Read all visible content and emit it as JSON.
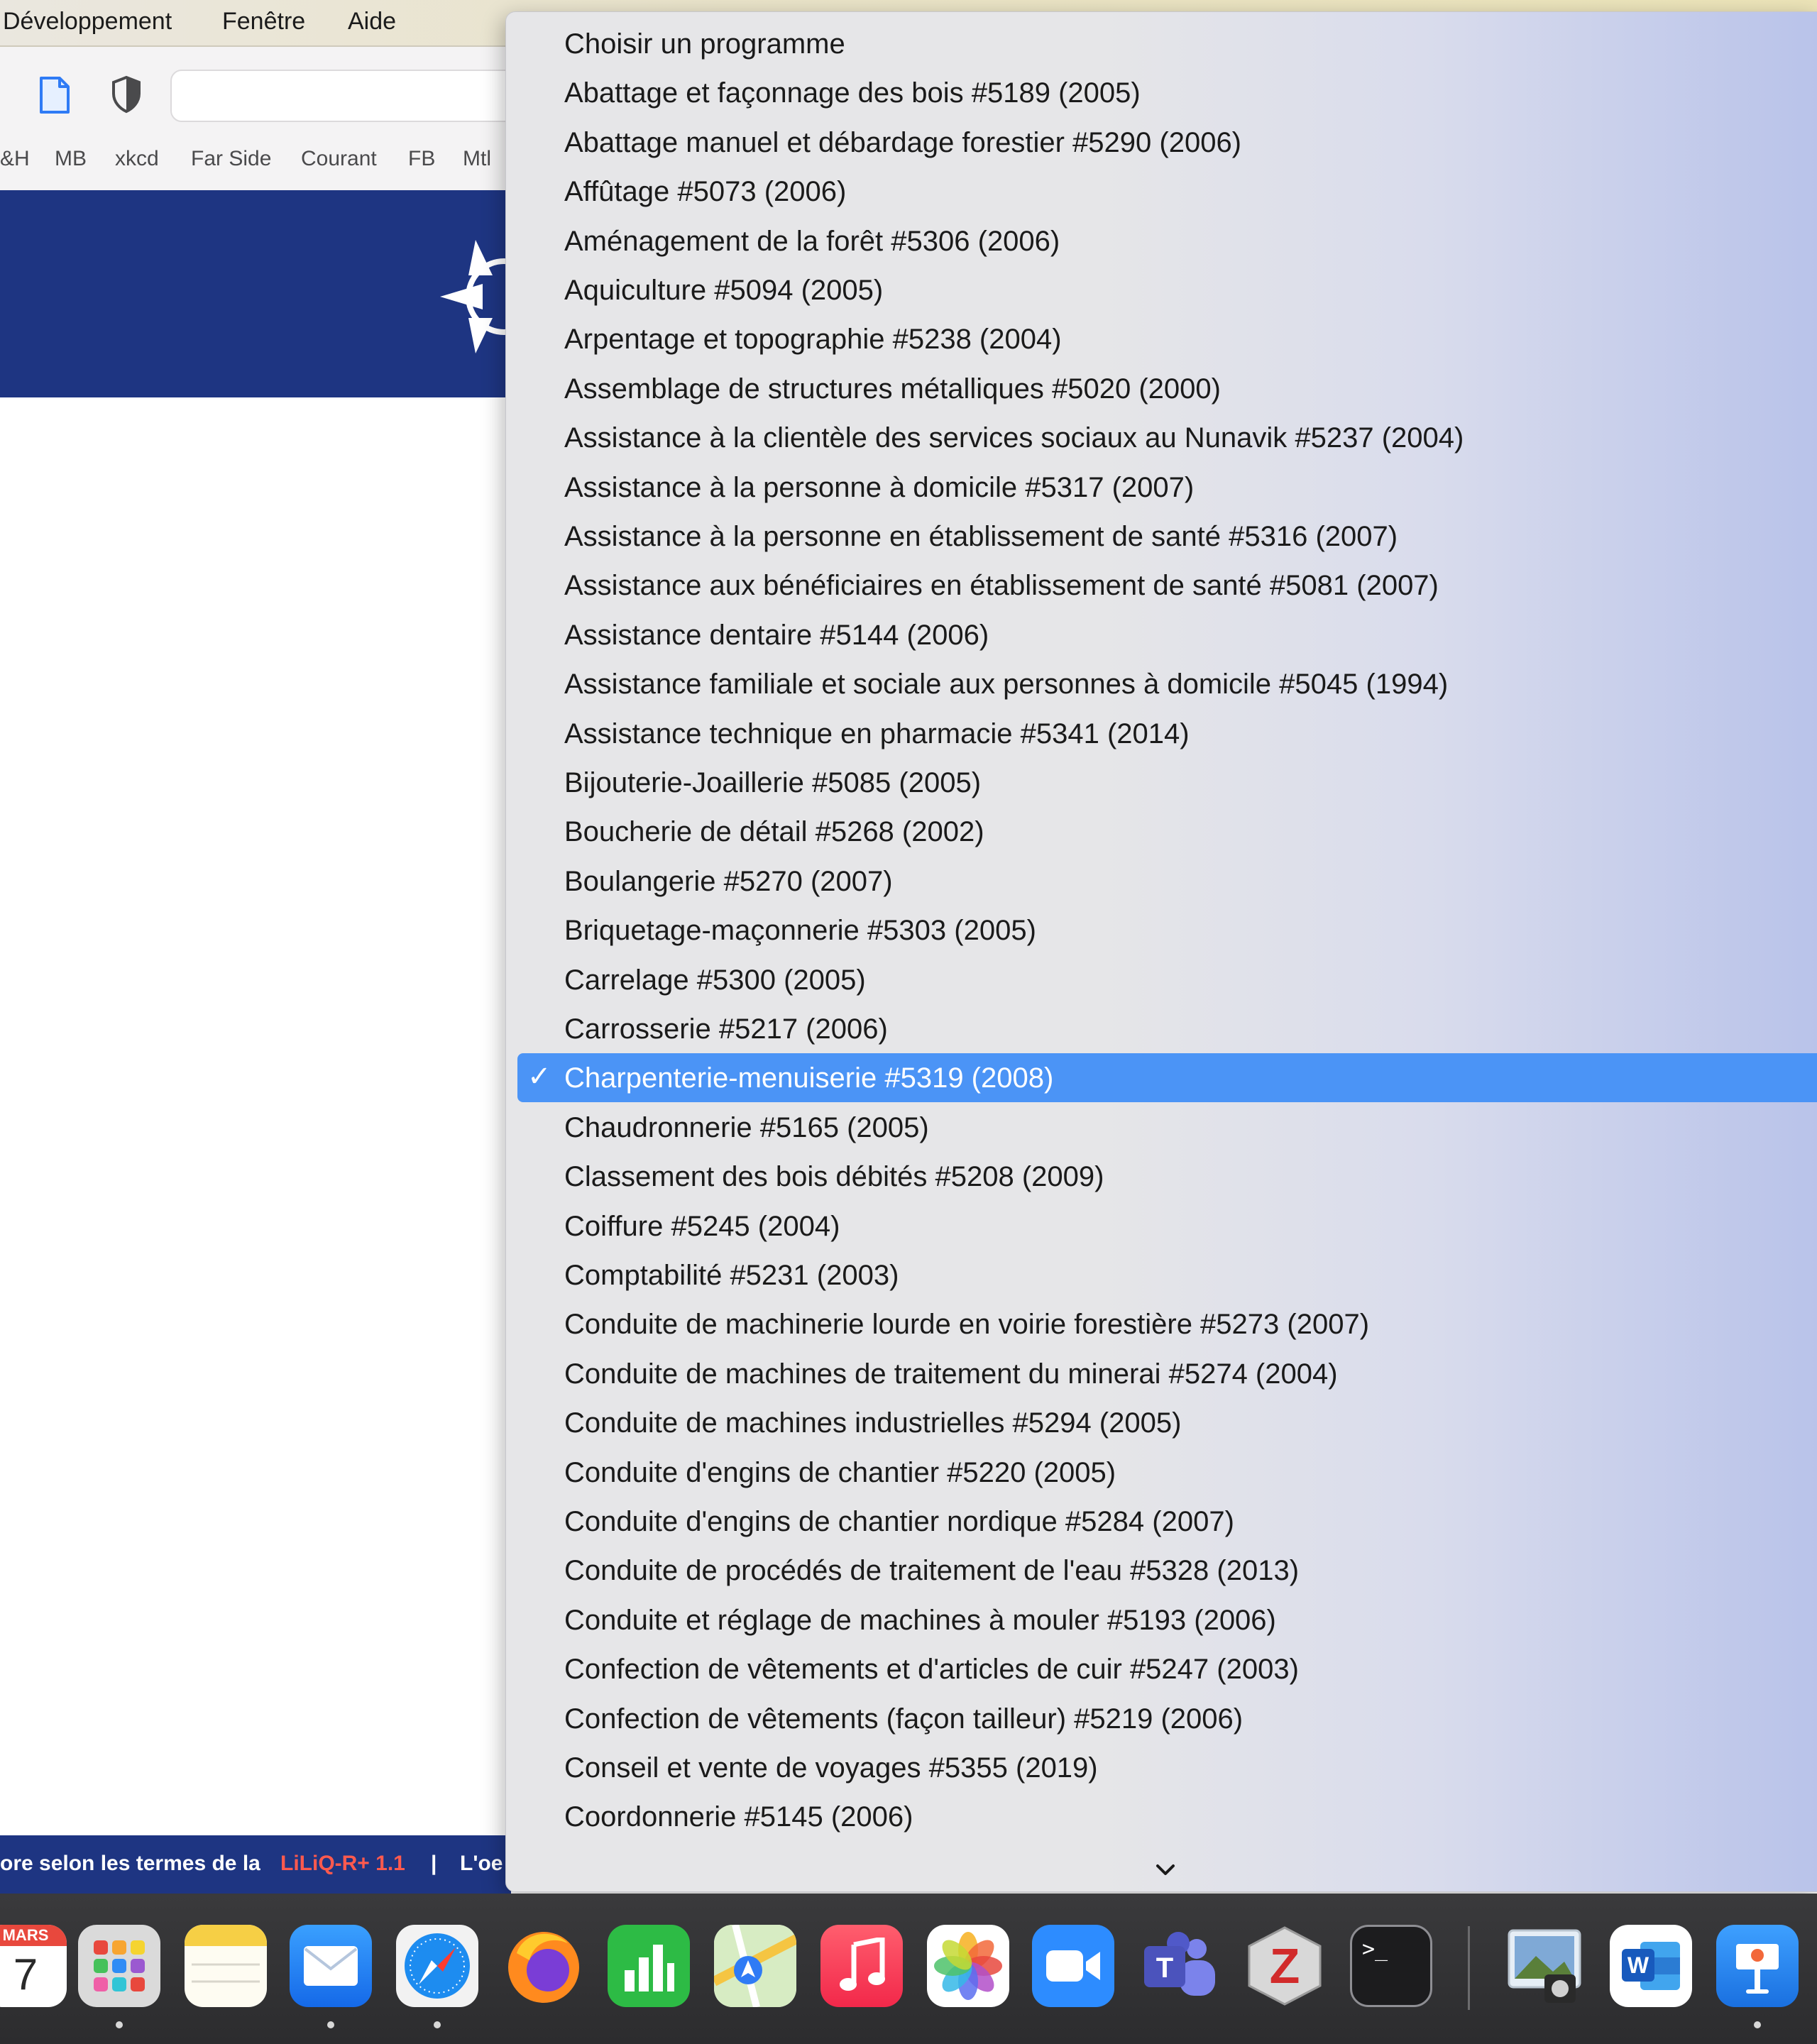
{
  "menubar": {
    "items": [
      "Développement",
      "Fenêtre",
      "Aide"
    ]
  },
  "toolbar": {
    "bookmarks": [
      "&H",
      "MB",
      "xkcd",
      "Far Side",
      "Courant",
      "FB",
      "Mtl"
    ]
  },
  "footer": {
    "text_before": "ore selon les termes de la",
    "link": "LiLiQ-R+ 1.1",
    "separator": "|",
    "text_after": "L'oe"
  },
  "dropdown": {
    "selected_index": 21,
    "options": [
      "Choisir un programme",
      "Abattage et façonnage des bois #5189 (2005)",
      "Abattage manuel et débardage forestier #5290 (2006)",
      "Affûtage #5073 (2006)",
      "Aménagement de la forêt #5306 (2006)",
      "Aquiculture #5094 (2005)",
      "Arpentage et topographie #5238 (2004)",
      "Assemblage de structures métalliques #5020 (2000)",
      "Assistance à la clientèle des services sociaux au Nunavik #5237 (2004)",
      "Assistance à la personne à domicile #5317 (2007)",
      "Assistance à la personne en établissement de santé #5316 (2007)",
      "Assistance aux bénéficiaires en établissement de santé #5081 (2007)",
      "Assistance dentaire #5144 (2006)",
      "Assistance familiale et sociale aux personnes à domicile #5045 (1994)",
      "Assistance technique en pharmacie #5341 (2014)",
      "Bijouterie-Joaillerie #5085 (2005)",
      "Boucherie de détail #5268 (2002)",
      "Boulangerie #5270 (2007)",
      "Briquetage-maçonnerie #5303 (2005)",
      "Carrelage #5300 (2005)",
      "Carrosserie #5217 (2006)",
      "Charpenterie-menuiserie #5319 (2008)",
      "Chaudronnerie #5165 (2005)",
      "Classement des bois débités #5208 (2009)",
      "Coiffure #5245 (2004)",
      "Comptabilité #5231 (2003)",
      "Conduite de machinerie lourde en voirie forestière #5273 (2007)",
      "Conduite de machines de traitement du minerai #5274 (2004)",
      "Conduite de machines industrielles #5294 (2005)",
      "Conduite d'engins de chantier #5220 (2005)",
      "Conduite d'engins de chantier nordique #5284 (2007)",
      "Conduite de procédés de traitement de l'eau #5328 (2013)",
      "Conduite et réglage de machines à mouler #5193 (2006)",
      "Confection de vêtements et d'articles de cuir #5247 (2003)",
      "Confection de vêtements (façon tailleur) #5219 (2006)",
      "Conseil et vente de voyages #5355 (2019)",
      "Coordonnerie #5145 (2006)"
    ],
    "check_glyph": "✓"
  },
  "dock": {
    "calendar": {
      "month": "MARS",
      "day": "7"
    },
    "terminal_prompt": ">_",
    "apps": [
      {
        "name": "calendar-app",
        "icon": "calendar-icon",
        "running": false
      },
      {
        "name": "launchpad-app",
        "icon": "launchpad-icon",
        "running": true
      },
      {
        "name": "notes-app",
        "icon": "notes-icon",
        "running": false
      },
      {
        "name": "mail-app",
        "icon": "mail-icon",
        "running": true
      },
      {
        "name": "safari-app",
        "icon": "safari-icon",
        "running": true
      },
      {
        "name": "firefox-app",
        "icon": "firefox-icon",
        "running": false
      },
      {
        "name": "numbers-app",
        "icon": "numbers-icon",
        "running": false
      },
      {
        "name": "maps-app",
        "icon": "maps-icon",
        "running": false
      },
      {
        "name": "music-app",
        "icon": "music-icon",
        "running": false
      },
      {
        "name": "photos-app",
        "icon": "photos-icon",
        "running": false
      },
      {
        "name": "zoom-app",
        "icon": "zoom-icon",
        "running": false
      },
      {
        "name": "teams-app",
        "icon": "teams-icon",
        "running": false
      },
      {
        "name": "zotero-app",
        "icon": "zotero-icon",
        "running": false
      },
      {
        "name": "terminal-app",
        "icon": "terminal-icon",
        "running": false
      },
      {
        "name": "preview-app",
        "icon": "preview-icon",
        "running": false
      },
      {
        "name": "word-app",
        "icon": "word-icon",
        "running": false
      },
      {
        "name": "keynote-app",
        "icon": "keynote-icon",
        "running": true
      }
    ]
  },
  "colors": {
    "accent_selected": "#4b94f6",
    "banner_navy": "#1e3582",
    "footer_link": "#ff5a4e"
  }
}
